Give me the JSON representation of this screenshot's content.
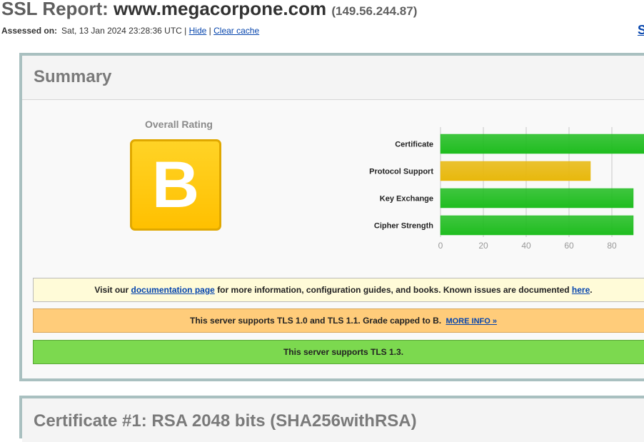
{
  "header": {
    "title_prefix": "SSL Report:",
    "host": "www.megacorpone.com",
    "ip": "(149.56.244.87)",
    "assessed_label": "Assessed on:",
    "assessed_date": "Sat, 13 Jan 2024 23:28:36 UTC",
    "separator1": "|",
    "hide_link": "Hide",
    "separator2": "|",
    "clear_cache_link": "Clear cache",
    "scan_link": "S"
  },
  "summary": {
    "title": "Summary",
    "overall_rating_label": "Overall Rating",
    "grade": "B",
    "grade_color": "#ffc000"
  },
  "chart_data": {
    "type": "bar",
    "orientation": "horizontal",
    "categories": [
      "Certificate",
      "Protocol Support",
      "Key Exchange",
      "Cipher Strength"
    ],
    "values": [
      100,
      70,
      90,
      90
    ],
    "colors": [
      "#1fbd1f",
      "#e8b80c",
      "#1fbd1f",
      "#1fbd1f"
    ],
    "xlim": [
      0,
      100
    ],
    "xticks": [
      0,
      20,
      40,
      60,
      80,
      100
    ],
    "grid": true
  },
  "notices": {
    "docs": {
      "text1": "Visit our",
      "link1": "documentation page",
      "text2": "for more information, configuration guides, and books. Known issues are documented",
      "link2": "here",
      "text3": "."
    },
    "tls": {
      "text": "This server supports TLS 1.0 and TLS 1.1. Grade capped to B.",
      "link": "MORE INFO »",
      "color": "#ffcc7a"
    },
    "tls13": {
      "text": "This server supports TLS 1.3.",
      "color": "#7cd94f"
    }
  },
  "certificate": {
    "title": "Certificate #1: RSA 2048 bits (SHA256withRSA)"
  }
}
